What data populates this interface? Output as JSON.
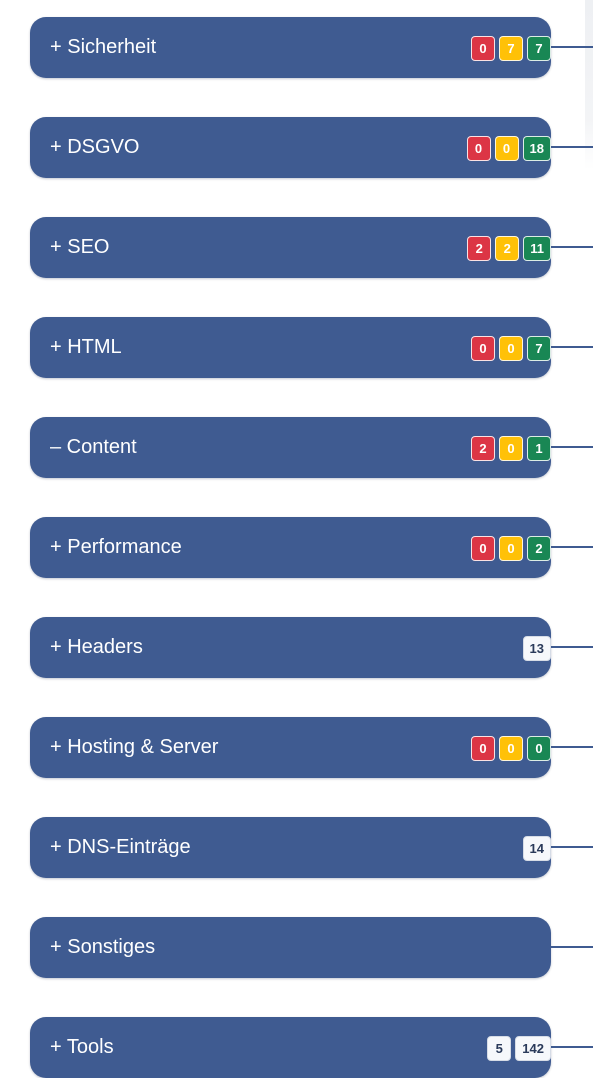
{
  "colors": {
    "pill_bg": "#3f5b91",
    "badge_red": "#dc3545",
    "badge_yellow": "#ffc107",
    "badge_green": "#198754",
    "badge_light": "#f6f8fb"
  },
  "sections": [
    {
      "label": "+ Sicherheit",
      "badges": [
        {
          "value": "0",
          "color": "red"
        },
        {
          "value": "7",
          "color": "yellow"
        },
        {
          "value": "7",
          "color": "green"
        }
      ]
    },
    {
      "label": "+ DSGVO",
      "badges": [
        {
          "value": "0",
          "color": "red"
        },
        {
          "value": "0",
          "color": "yellow"
        },
        {
          "value": "18",
          "color": "green"
        }
      ]
    },
    {
      "label": "+ SEO",
      "badges": [
        {
          "value": "2",
          "color": "red"
        },
        {
          "value": "2",
          "color": "yellow"
        },
        {
          "value": "11",
          "color": "green"
        }
      ]
    },
    {
      "label": "+ HTML",
      "badges": [
        {
          "value": "0",
          "color": "red"
        },
        {
          "value": "0",
          "color": "yellow"
        },
        {
          "value": "7",
          "color": "green"
        }
      ]
    },
    {
      "label": "– Content",
      "badges": [
        {
          "value": "2",
          "color": "red"
        },
        {
          "value": "0",
          "color": "yellow"
        },
        {
          "value": "1",
          "color": "green"
        }
      ]
    },
    {
      "label": "+ Performance",
      "badges": [
        {
          "value": "0",
          "color": "red"
        },
        {
          "value": "0",
          "color": "yellow"
        },
        {
          "value": "2",
          "color": "green"
        }
      ]
    },
    {
      "label": "+ Headers",
      "badges": [
        {
          "value": "13",
          "color": "light"
        }
      ]
    },
    {
      "label": "+ Hosting & Server",
      "badges": [
        {
          "value": "0",
          "color": "red"
        },
        {
          "value": "0",
          "color": "yellow"
        },
        {
          "value": "0",
          "color": "green"
        }
      ]
    },
    {
      "label": "+ DNS-Einträge",
      "badges": [
        {
          "value": "14",
          "color": "light"
        }
      ]
    },
    {
      "label": "+ Sonstiges",
      "badges": []
    },
    {
      "label": "+ Tools",
      "badges": [
        {
          "value": "5",
          "color": "light"
        },
        {
          "value": "142",
          "color": "light"
        }
      ]
    }
  ]
}
